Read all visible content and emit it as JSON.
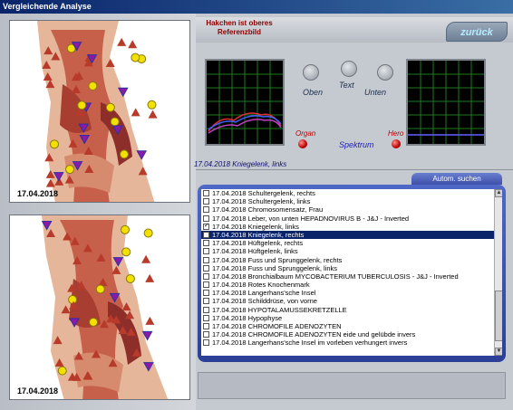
{
  "window": {
    "title": "Vergleichende Analyse"
  },
  "images": {
    "top_date": "17.04.2018",
    "bottom_date": "17.04.2018"
  },
  "header": {
    "reference_line1": "Hakchen ist oberes",
    "reference_line2": "Referenzbild",
    "back_label": "zurück"
  },
  "controls": {
    "oben_label": "Oben",
    "text_label": "Text",
    "unten_label": "Unten",
    "organ_label": "Organ",
    "hero_label": "Hero",
    "spektrum_label": "Spektrum"
  },
  "selected_item": "17.04.2018 Kniegelenk, links",
  "search": {
    "tab_label": "Autom. suchen"
  },
  "list": {
    "items": [
      {
        "label": "17.04.2018  Schultergelenk, rechts",
        "checked": false,
        "selected": false
      },
      {
        "label": "17.04.2018  Schultergelenk, links",
        "checked": false,
        "selected": false
      },
      {
        "label": "17.04.2018  Chromosomensatz, Frau",
        "checked": false,
        "selected": false
      },
      {
        "label": "17.04.2018  Leber, von unten  HEPADNOVIRUS  B  -  J&J - Inverted",
        "checked": false,
        "selected": false
      },
      {
        "label": "17.04.2018  Kniegelenk, links",
        "checked": true,
        "selected": false
      },
      {
        "label": "17.04.2018  Kniegelenk, rechts",
        "checked": false,
        "selected": true
      },
      {
        "label": "17.04.2018  Hüftgelenk, rechts",
        "checked": false,
        "selected": false
      },
      {
        "label": "17.04.2018  Hüftgelenk, links",
        "checked": false,
        "selected": false
      },
      {
        "label": "17.04.2018  Fuss und Sprunggelenk, rechts",
        "checked": false,
        "selected": false
      },
      {
        "label": "17.04.2018  Fuss und Sprunggelenk, links",
        "checked": false,
        "selected": false
      },
      {
        "label": "17.04.2018  Bronchialbaum  MYCOBACTERIUM  TUBERCULOSIS  -  J&J - Inverted",
        "checked": false,
        "selected": false
      },
      {
        "label": "17.04.2018  Rotes Knochenmark",
        "checked": false,
        "selected": false
      },
      {
        "label": "17.04.2018  Langerhans'sche Insel",
        "checked": false,
        "selected": false
      },
      {
        "label": "17.04.2018  Schilddrüse, von vorne",
        "checked": false,
        "selected": false
      },
      {
        "label": "17.04.2018  HYPOTALAMUSSEKRETZELLE",
        "checked": false,
        "selected": false
      },
      {
        "label": "17.04.2018  Hypophyse",
        "checked": false,
        "selected": false
      },
      {
        "label": "17.04.2018  CHROMOFILE ADENOZYTEN",
        "checked": false,
        "selected": false
      },
      {
        "label": "17.04.2018  CHROMOFILE ADENOZYTEN  eide und gelübde invers",
        "checked": false,
        "selected": false
      },
      {
        "label": "17.04.2018  Langerhans'sche Insel  im vorleben verhungert invers",
        "checked": false,
        "selected": false
      }
    ]
  },
  "colors": {
    "accent": "#3d4fa8",
    "selection": "#0a246a",
    "led": "#c00000",
    "marker_triangle": "#b83a2a",
    "marker_hexagon": "#f2e000",
    "marker_down": "#8a1aa8"
  }
}
